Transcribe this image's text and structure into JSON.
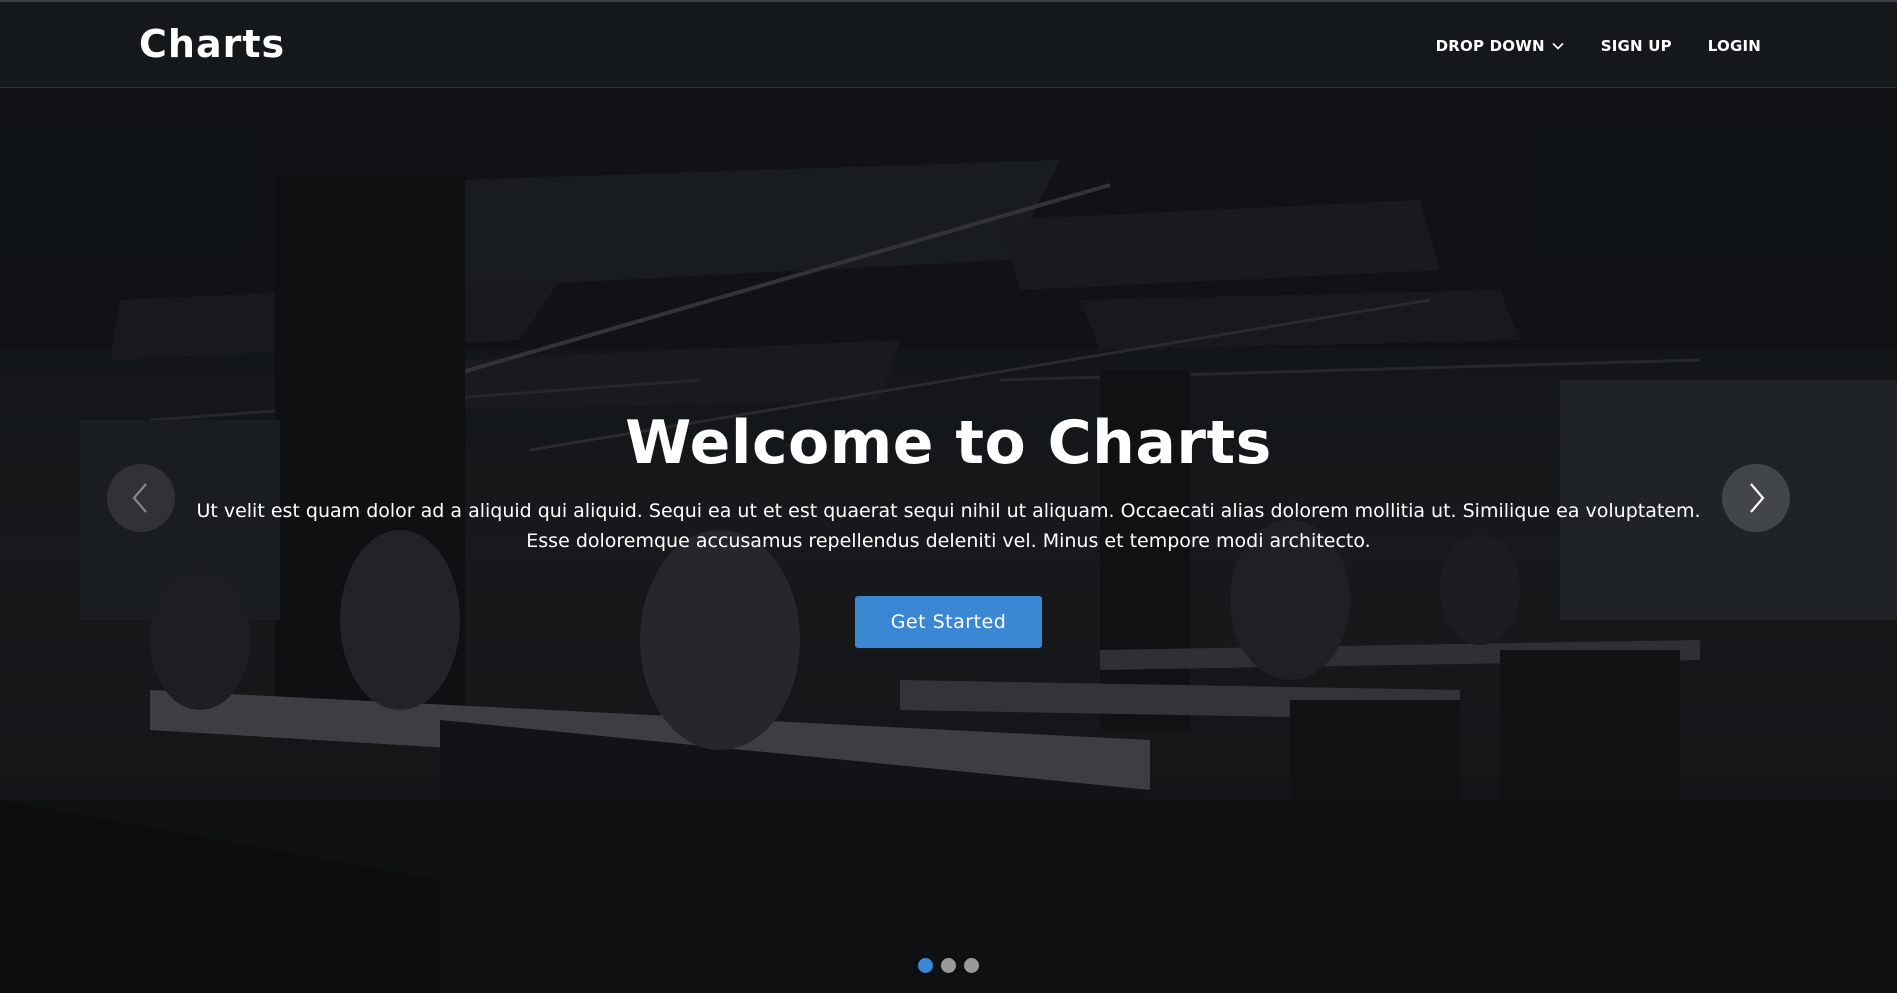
{
  "navbar": {
    "brand": "Charts",
    "links": [
      {
        "label": "DROP DOWN",
        "icon": "chevron-down-icon"
      },
      {
        "label": "SIGN UP"
      },
      {
        "label": "LOGIN"
      }
    ]
  },
  "hero": {
    "title": "Welcome to Charts",
    "text": "Ut velit est quam dolor ad a aliquid qui aliquid. Sequi ea ut et est quaerat sequi nihil ut aliquam. Occaecati alias dolorem mollitia ut. Similique ea voluptatem. Esse doloremque accusamus repellendus deleniti vel. Minus et tempore modi architecto.",
    "cta_label": "Get Started"
  },
  "carousel": {
    "prev_icon": "chevron-left-icon",
    "next_icon": "chevron-right-icon",
    "slide_count": 3,
    "active_slide": 1
  },
  "colors": {
    "accent": "#3b87d3",
    "navbar_bg": "#16191d",
    "indicator_inactive": "#9a9a9a"
  }
}
